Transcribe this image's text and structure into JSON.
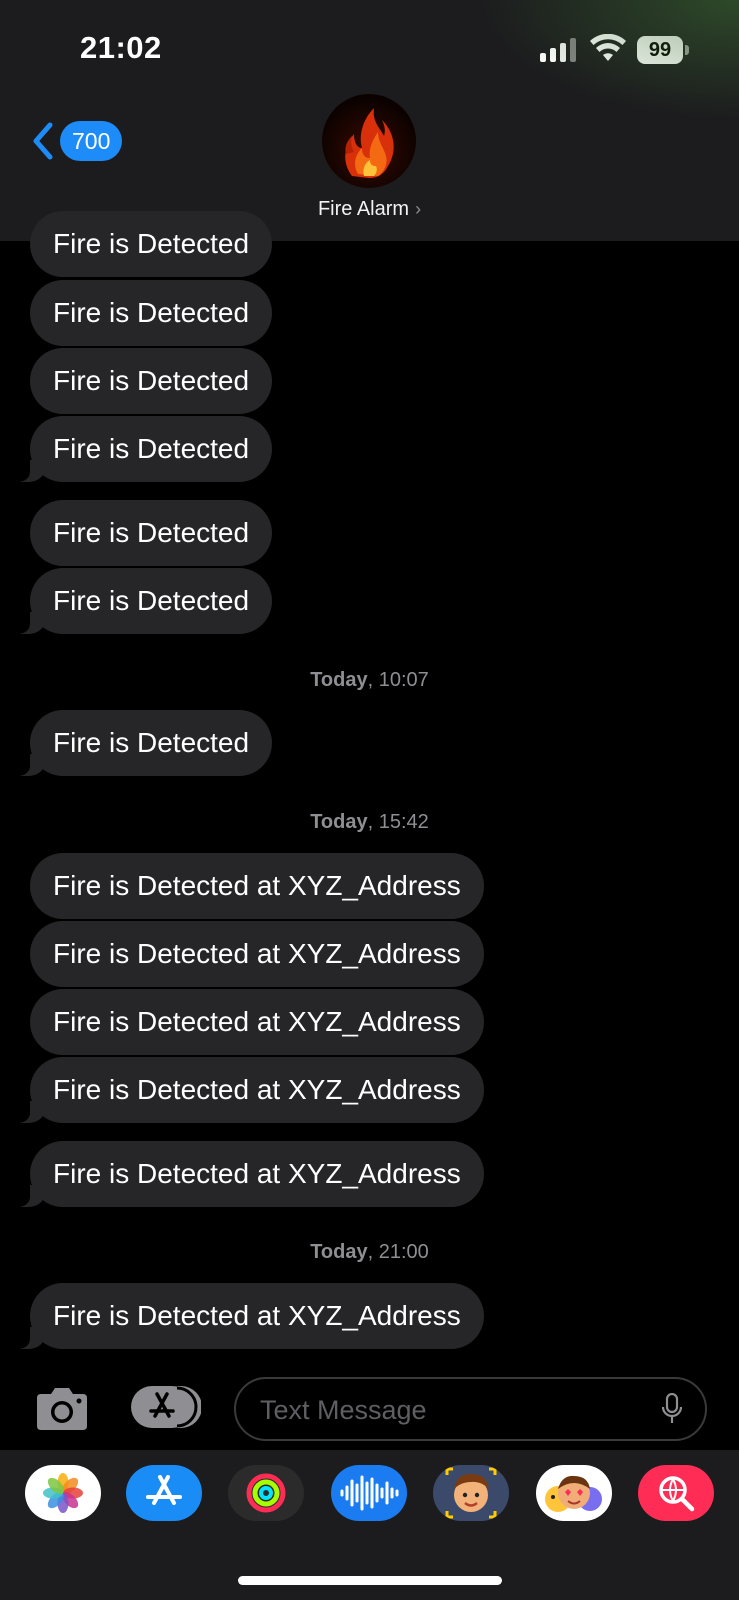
{
  "status_bar": {
    "time": "21:02",
    "battery": "99"
  },
  "header": {
    "back_count": "700",
    "contact_name": "Fire Alarm",
    "contact_chevron": "›"
  },
  "messages": [
    {
      "type": "bubble",
      "text": "Fire is Detected"
    },
    {
      "type": "bubble",
      "text": "Fire is Detected"
    },
    {
      "type": "bubble",
      "text": "Fire is Detected"
    },
    {
      "type": "bubble",
      "text": "Fire is Detected"
    },
    {
      "type": "bubble",
      "text": "Fire is Detected"
    },
    {
      "type": "bubble",
      "text": "Fire is Detected"
    },
    {
      "type": "timestamp",
      "day": "Today",
      "time": "10:07"
    },
    {
      "type": "bubble",
      "text": "Fire is Detected"
    },
    {
      "type": "timestamp",
      "day": "Today",
      "time": "15:42"
    },
    {
      "type": "bubble",
      "text": "Fire is Detected at XYZ_Address"
    },
    {
      "type": "bubble",
      "text": "Fire is Detected at XYZ_Address"
    },
    {
      "type": "bubble",
      "text": "Fire is Detected at XYZ_Address"
    },
    {
      "type": "bubble",
      "text": "Fire is Detected at XYZ_Address"
    },
    {
      "type": "bubble",
      "text": "Fire is Detected at XYZ_Address"
    },
    {
      "type": "timestamp",
      "day": "Today",
      "time": "21:00"
    },
    {
      "type": "bubble",
      "text": "Fire is Detected at XYZ_Address"
    }
  ],
  "composer": {
    "placeholder": "Text Message"
  },
  "dock_apps": [
    "photos-icon",
    "app-store-icon",
    "activity-icon",
    "voice-memos-icon",
    "memoji-icon",
    "animoji-icon",
    "web-images-icon"
  ],
  "colors": {
    "bubble": "#262628",
    "accent": "#1d8cf8",
    "header": "#1c1c1e"
  }
}
